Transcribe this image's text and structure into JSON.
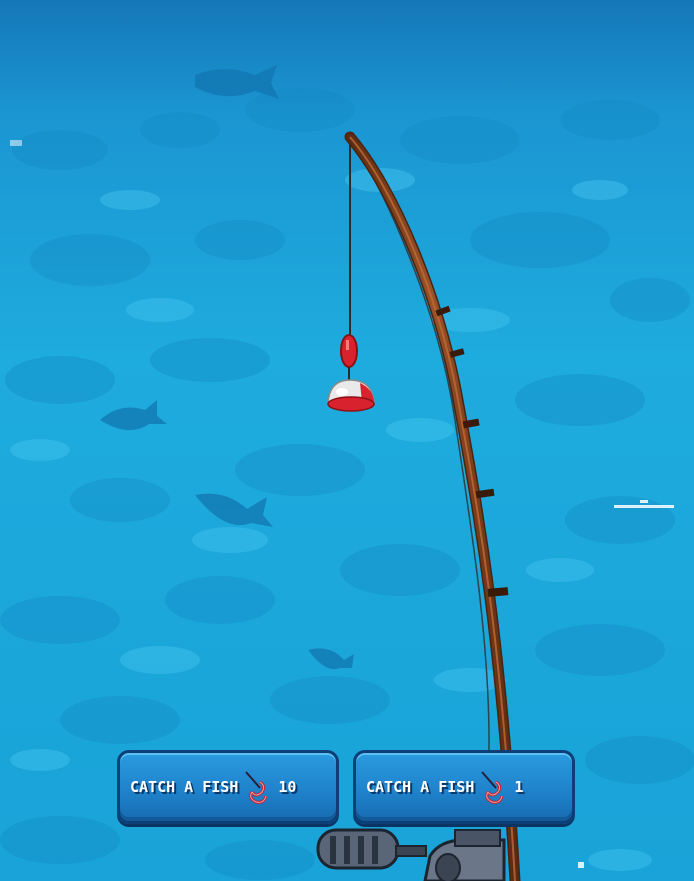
{
  "game": {
    "scene": "fishing",
    "icons": {
      "hook": "fishing-hook-icon",
      "bobber": "bobber",
      "rod": "fishing-rod",
      "reel": "reel"
    }
  },
  "actions": [
    {
      "label": "CATCH A FISH",
      "count": "10"
    },
    {
      "label": "CATCH A FISH",
      "count": "1"
    }
  ],
  "colors": {
    "water": "#1aa6d6",
    "button": "#1f83cc",
    "button_border": "#0c3f78",
    "bobber_red": "#d8232e",
    "rod": "#7a3f1e"
  }
}
